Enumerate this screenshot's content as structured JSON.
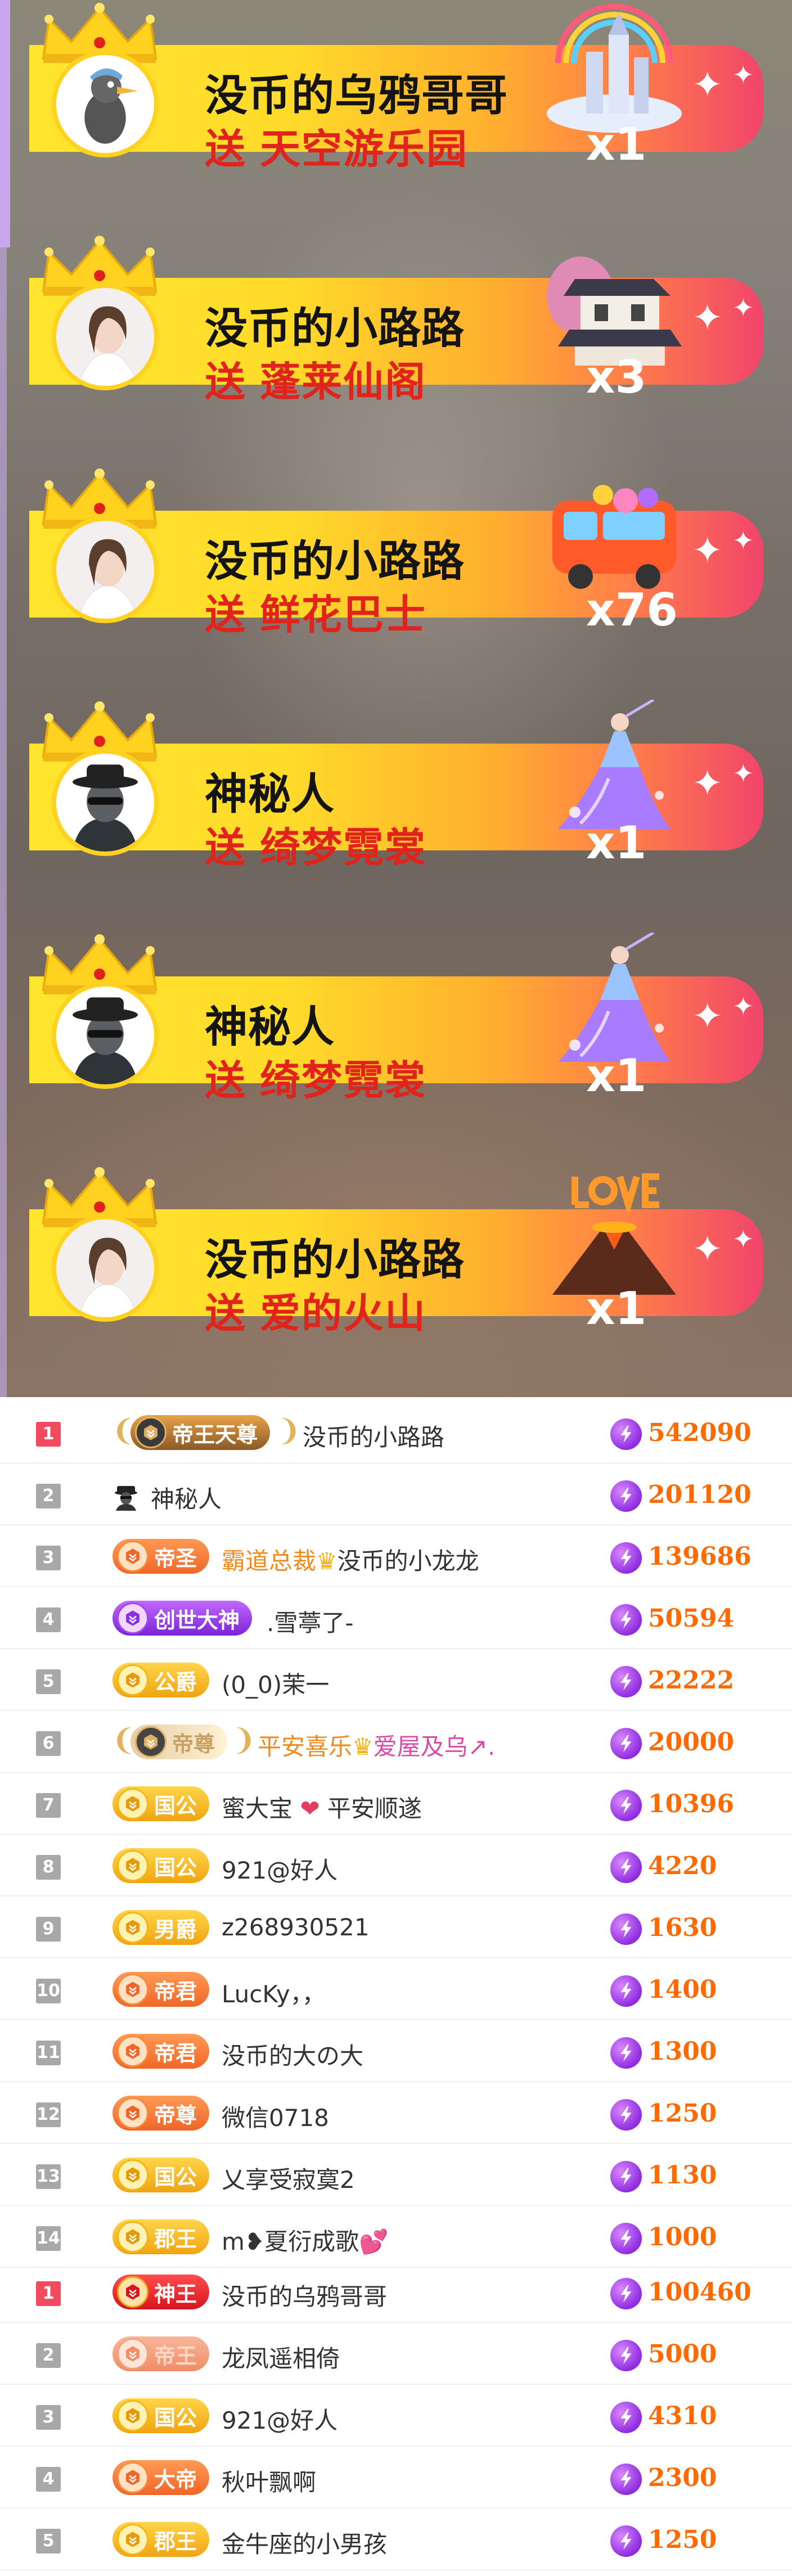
{
  "gift_banners": [
    {
      "name": "没币的乌鸦哥哥",
      "verb": "送",
      "gift": "天空游乐园",
      "count": "x1",
      "avatar_icon": "crow-avatar",
      "gift_icon": "sky-park-gift"
    },
    {
      "name": "没币的小路路",
      "verb": "送",
      "gift": "蓬莱仙阁",
      "count": "x3",
      "avatar_icon": "girl-avatar",
      "gift_icon": "pavilion-gift"
    },
    {
      "name": "没币的小路路",
      "verb": "送",
      "gift": "鲜花巴士",
      "count": "x76",
      "avatar_icon": "girl-avatar",
      "gift_icon": "flower-bus-gift"
    },
    {
      "name": "神秘人",
      "verb": "送",
      "gift": "绮梦霓裳",
      "count": "x1",
      "avatar_icon": "mystery-avatar",
      "gift_icon": "dress-fairy-gift"
    },
    {
      "name": "神秘人",
      "verb": "送",
      "gift": "绮梦霓裳",
      "count": "x1",
      "avatar_icon": "mystery-avatar",
      "gift_icon": "dress-fairy-gift"
    },
    {
      "name": "没币的小路路",
      "verb": "送",
      "gift": "爱的火山",
      "count": "x1",
      "avatar_icon": "girl-avatar",
      "gift_icon": "love-volcano-gift"
    }
  ],
  "ranking_1": [
    {
      "rank": "1",
      "badge": "帝王天尊",
      "badge_style": "dark",
      "name": "没币的小路路",
      "score": "542090"
    },
    {
      "rank": "2",
      "badge": "",
      "badge_style": "none",
      "name": "神秘人",
      "score": "201120"
    },
    {
      "rank": "3",
      "badge": "帝圣",
      "badge_style": "orange",
      "name_prefix": "霸道总裁",
      "name": "没币的小龙龙",
      "score": "139686"
    },
    {
      "rank": "4",
      "badge": "创世大神",
      "badge_style": "purple",
      "name": ".雪葶了-",
      "score": "50594"
    },
    {
      "rank": "5",
      "badge": "公爵",
      "badge_style": "gold",
      "name": "(0_0)茉一",
      "score": "22222"
    },
    {
      "rank": "6",
      "badge": "帝尊",
      "badge_style": "ghost",
      "name_prefix": "平安喜乐",
      "name": "爱屋及乌↗.",
      "score": "20000"
    },
    {
      "rank": "7",
      "badge": "国公",
      "badge_style": "gold",
      "name": "蜜大宝",
      "name_suffix": "平安顺遂",
      "score": "10396"
    },
    {
      "rank": "8",
      "badge": "国公",
      "badge_style": "gold",
      "name": "921@好人",
      "score": "4220"
    },
    {
      "rank": "9",
      "badge": "男爵",
      "badge_style": "gold",
      "name": "z268930521",
      "score": "1630"
    },
    {
      "rank": "10",
      "badge": "帝君",
      "badge_style": "orange",
      "name": "LucKy，，",
      "score": "1400"
    },
    {
      "rank": "11",
      "badge": "帝君",
      "badge_style": "orange",
      "name": "没币的大の大",
      "score": "1300"
    },
    {
      "rank": "12",
      "badge": "帝尊",
      "badge_style": "orange",
      "name": "微信0718",
      "score": "1250"
    },
    {
      "rank": "13",
      "badge": "国公",
      "badge_style": "gold",
      "name": "乂享受寂寞2",
      "score": "1130"
    },
    {
      "rank": "14",
      "badge": "郡王",
      "badge_style": "gold",
      "name": "m❥夏衍成歌",
      "score": "1000"
    }
  ],
  "ranking_2": [
    {
      "rank": "1",
      "badge": "神王",
      "badge_style": "red",
      "name": "没币的乌鸦哥哥",
      "score": "100460"
    },
    {
      "rank": "2",
      "badge": "帝王",
      "badge_style": "faded",
      "name": "龙凤遥相倚",
      "score": "5000"
    },
    {
      "rank": "3",
      "badge": "国公",
      "badge_style": "gold",
      "name": "921@好人",
      "score": "4310"
    },
    {
      "rank": "4",
      "badge": "大帝",
      "badge_style": "orange",
      "name": "秋叶飘啊",
      "score": "2300"
    },
    {
      "rank": "5",
      "badge": "郡王",
      "badge_style": "gold",
      "name": "金牛座的小男孩",
      "score": "1250"
    }
  ],
  "colors": {
    "rank_top": "#f24a5e",
    "rank_other": "#a8a8a8",
    "score": "#ff6a00",
    "gift_name": "#e0241c"
  }
}
